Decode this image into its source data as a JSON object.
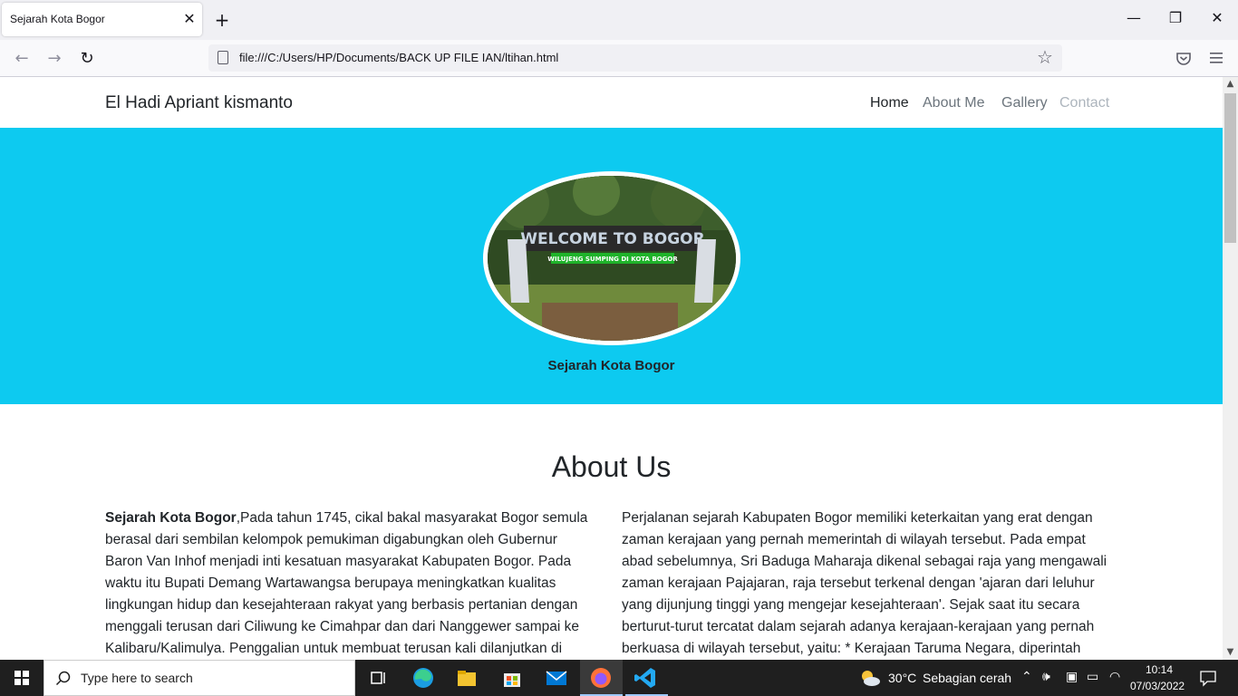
{
  "browser": {
    "tab_title": "Sejarah Kota Bogor",
    "url": "file:///C:/Users/HP/Documents/BACK UP FILE IAN/ltihan.html"
  },
  "site": {
    "brand": "El Hadi Apriant kismanto",
    "nav": [
      {
        "label": "Home",
        "color": "#212529"
      },
      {
        "label": "About Me",
        "color": "#6c757d"
      },
      {
        "label": "Gallery",
        "color": "#6c757d"
      },
      {
        "label": "Contact",
        "color": "#adb5bd"
      }
    ],
    "hero_caption": "Sejarah Kota Bogor",
    "hero_bg": "#0dcaf0",
    "hero_image": {
      "sign_text": "WELCOME TO BOGOR",
      "sub_text": "WILUJENG SUMPING DI KOTA BOGOR"
    },
    "about_title": "About Us",
    "about_left_bold": "Sejarah Kota Bogor",
    "about_left": ",Pada tahun 1745, cikal bakal masyarakat Bogor semula berasal dari sembilan kelompok pemukiman digabungkan oleh Gubernur Baron Van Inhof menjadi inti kesatuan masyarakat Kabupaten Bogor. Pada waktu itu Bupati Demang Wartawangsa berupaya meningkatkan kualitas lingkungan hidup dan kesejahteraan rakyat yang berbasis pertanian dengan menggali terusan dari Ciliwung ke Cimahpar dan dari Nanggewer sampai ke Kalibaru/Kalimulya. Penggalian untuk membuat terusan kali dilanjutkan di",
    "about_right": "Perjalanan sejarah Kabupaten Bogor memiliki keterkaitan yang erat dengan zaman kerajaan yang pernah memerintah di wilayah tersebut. Pada empat abad sebelumnya, Sri Baduga Maharaja dikenal sebagai raja yang mengawali zaman kerajaan Pajajaran, raja tersebut terkenal dengan 'ajaran dari leluhur yang dijunjung tinggi yang mengejar kesejahteraan'. Sejak saat itu secara berturut-turut tercatat dalam sejarah adanya kerajaan-kerajaan yang pernah berkuasa di wilayah tersebut, yaitu: * Kerajaan Taruma Negara, diperintah"
  },
  "taskbar": {
    "search_placeholder": "Type here to search",
    "weather_temp": "30°C",
    "weather_desc": "Sebagian cerah",
    "time": "10:14",
    "date": "07/03/2022"
  }
}
